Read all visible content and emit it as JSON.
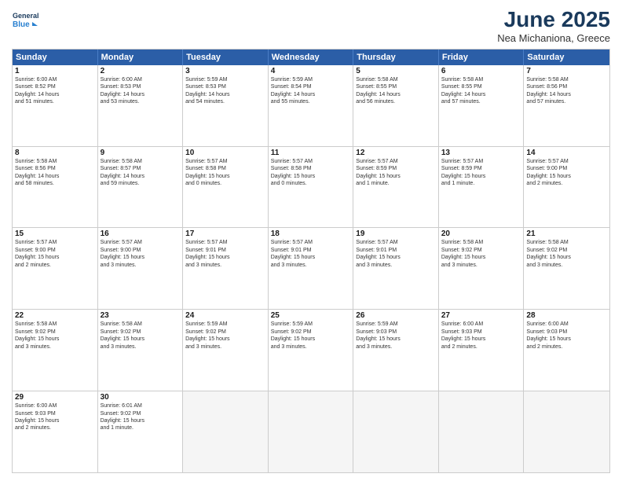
{
  "header": {
    "logo_line1": "General",
    "logo_line2": "Blue",
    "month": "June 2025",
    "location": "Nea Michaniona, Greece"
  },
  "weekdays": [
    "Sunday",
    "Monday",
    "Tuesday",
    "Wednesday",
    "Thursday",
    "Friday",
    "Saturday"
  ],
  "rows": [
    [
      {
        "day": "1",
        "text": "Sunrise: 6:00 AM\nSunset: 8:52 PM\nDaylight: 14 hours\nand 51 minutes."
      },
      {
        "day": "2",
        "text": "Sunrise: 6:00 AM\nSunset: 8:53 PM\nDaylight: 14 hours\nand 53 minutes."
      },
      {
        "day": "3",
        "text": "Sunrise: 5:59 AM\nSunset: 8:53 PM\nDaylight: 14 hours\nand 54 minutes."
      },
      {
        "day": "4",
        "text": "Sunrise: 5:59 AM\nSunset: 8:54 PM\nDaylight: 14 hours\nand 55 minutes."
      },
      {
        "day": "5",
        "text": "Sunrise: 5:58 AM\nSunset: 8:55 PM\nDaylight: 14 hours\nand 56 minutes."
      },
      {
        "day": "6",
        "text": "Sunrise: 5:58 AM\nSunset: 8:55 PM\nDaylight: 14 hours\nand 57 minutes."
      },
      {
        "day": "7",
        "text": "Sunrise: 5:58 AM\nSunset: 8:56 PM\nDaylight: 14 hours\nand 57 minutes."
      }
    ],
    [
      {
        "day": "8",
        "text": "Sunrise: 5:58 AM\nSunset: 8:56 PM\nDaylight: 14 hours\nand 58 minutes."
      },
      {
        "day": "9",
        "text": "Sunrise: 5:58 AM\nSunset: 8:57 PM\nDaylight: 14 hours\nand 59 minutes."
      },
      {
        "day": "10",
        "text": "Sunrise: 5:57 AM\nSunset: 8:58 PM\nDaylight: 15 hours\nand 0 minutes."
      },
      {
        "day": "11",
        "text": "Sunrise: 5:57 AM\nSunset: 8:58 PM\nDaylight: 15 hours\nand 0 minutes."
      },
      {
        "day": "12",
        "text": "Sunrise: 5:57 AM\nSunset: 8:59 PM\nDaylight: 15 hours\nand 1 minute."
      },
      {
        "day": "13",
        "text": "Sunrise: 5:57 AM\nSunset: 8:59 PM\nDaylight: 15 hours\nand 1 minute."
      },
      {
        "day": "14",
        "text": "Sunrise: 5:57 AM\nSunset: 9:00 PM\nDaylight: 15 hours\nand 2 minutes."
      }
    ],
    [
      {
        "day": "15",
        "text": "Sunrise: 5:57 AM\nSunset: 9:00 PM\nDaylight: 15 hours\nand 2 minutes."
      },
      {
        "day": "16",
        "text": "Sunrise: 5:57 AM\nSunset: 9:00 PM\nDaylight: 15 hours\nand 3 minutes."
      },
      {
        "day": "17",
        "text": "Sunrise: 5:57 AM\nSunset: 9:01 PM\nDaylight: 15 hours\nand 3 minutes."
      },
      {
        "day": "18",
        "text": "Sunrise: 5:57 AM\nSunset: 9:01 PM\nDaylight: 15 hours\nand 3 minutes."
      },
      {
        "day": "19",
        "text": "Sunrise: 5:57 AM\nSunset: 9:01 PM\nDaylight: 15 hours\nand 3 minutes."
      },
      {
        "day": "20",
        "text": "Sunrise: 5:58 AM\nSunset: 9:02 PM\nDaylight: 15 hours\nand 3 minutes."
      },
      {
        "day": "21",
        "text": "Sunrise: 5:58 AM\nSunset: 9:02 PM\nDaylight: 15 hours\nand 3 minutes."
      }
    ],
    [
      {
        "day": "22",
        "text": "Sunrise: 5:58 AM\nSunset: 9:02 PM\nDaylight: 15 hours\nand 3 minutes."
      },
      {
        "day": "23",
        "text": "Sunrise: 5:58 AM\nSunset: 9:02 PM\nDaylight: 15 hours\nand 3 minutes."
      },
      {
        "day": "24",
        "text": "Sunrise: 5:59 AM\nSunset: 9:02 PM\nDaylight: 15 hours\nand 3 minutes."
      },
      {
        "day": "25",
        "text": "Sunrise: 5:59 AM\nSunset: 9:02 PM\nDaylight: 15 hours\nand 3 minutes."
      },
      {
        "day": "26",
        "text": "Sunrise: 5:59 AM\nSunset: 9:03 PM\nDaylight: 15 hours\nand 3 minutes."
      },
      {
        "day": "27",
        "text": "Sunrise: 6:00 AM\nSunset: 9:03 PM\nDaylight: 15 hours\nand 2 minutes."
      },
      {
        "day": "28",
        "text": "Sunrise: 6:00 AM\nSunset: 9:03 PM\nDaylight: 15 hours\nand 2 minutes."
      }
    ],
    [
      {
        "day": "29",
        "text": "Sunrise: 6:00 AM\nSunset: 9:03 PM\nDaylight: 15 hours\nand 2 minutes."
      },
      {
        "day": "30",
        "text": "Sunrise: 6:01 AM\nSunset: 9:02 PM\nDaylight: 15 hours\nand 1 minute."
      },
      {
        "day": "",
        "text": ""
      },
      {
        "day": "",
        "text": ""
      },
      {
        "day": "",
        "text": ""
      },
      {
        "day": "",
        "text": ""
      },
      {
        "day": "",
        "text": ""
      }
    ]
  ]
}
